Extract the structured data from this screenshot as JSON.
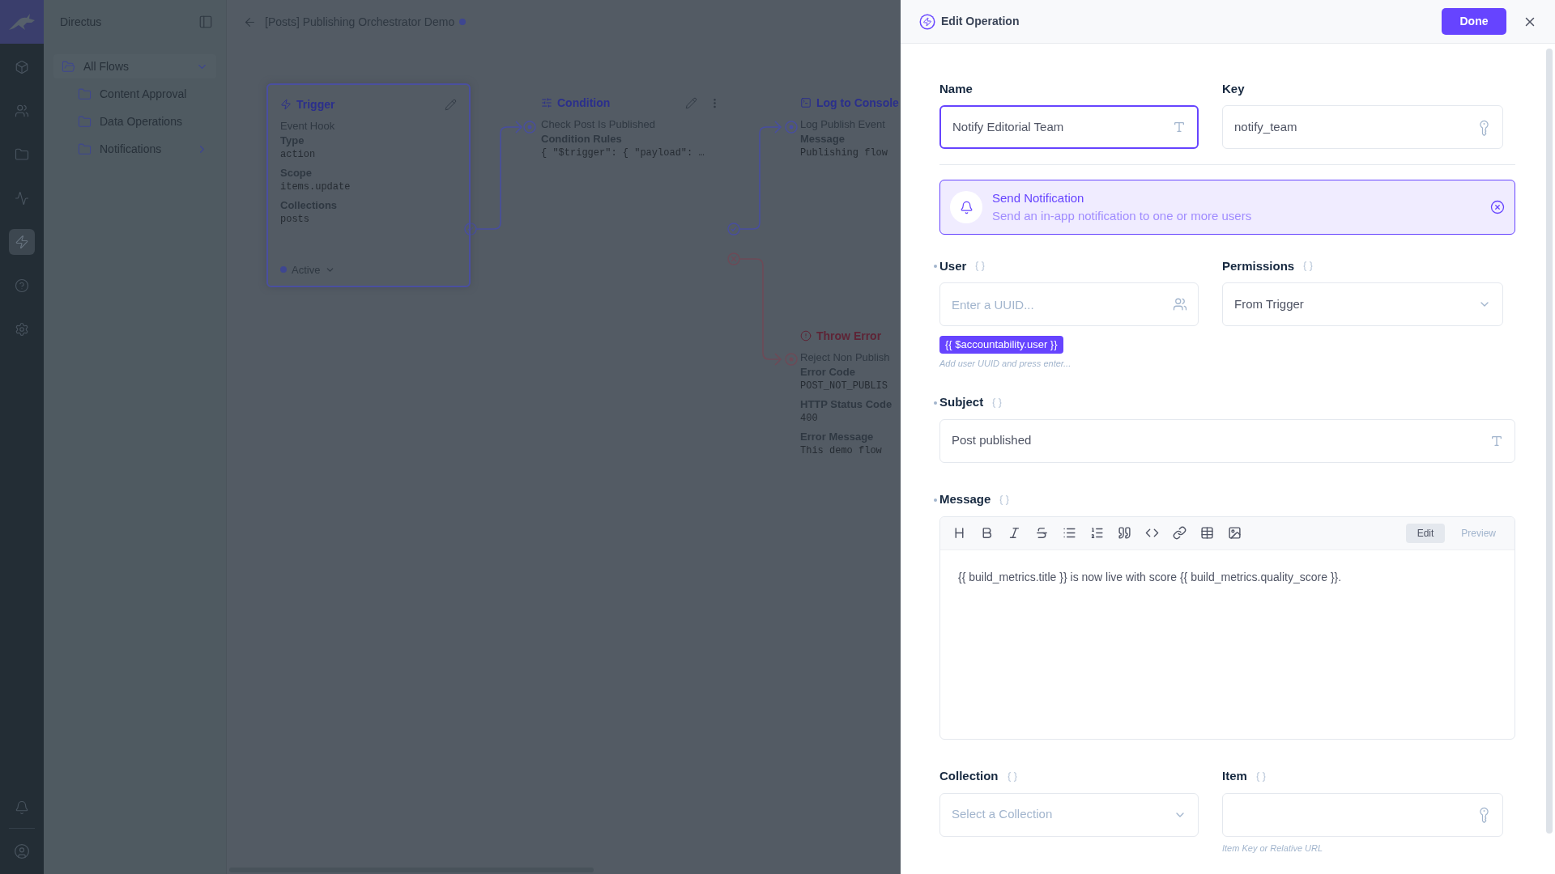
{
  "rail": {
    "items": [
      {
        "selected": false
      },
      {
        "selected": false
      },
      {
        "selected": false
      },
      {
        "selected": false
      },
      {
        "selected": true
      },
      {
        "selected": false
      },
      {
        "selected": false
      }
    ]
  },
  "sidebar": {
    "title": "Directus",
    "items": [
      {
        "label": "All Flows",
        "kind": "root",
        "expanded": true,
        "children": [
          {
            "label": "Content Approval",
            "kind": "folder"
          },
          {
            "label": "Data Operations",
            "kind": "folder"
          },
          {
            "label": "Notifications",
            "kind": "group",
            "expanded": false
          }
        ]
      }
    ]
  },
  "header": {
    "title": "[Posts] Publishing Orchestrator Demo",
    "unsaved": true
  },
  "canvas": {
    "nodes": [
      {
        "kind": "trigger",
        "title": "Trigger",
        "color": "#2b2f8c",
        "name": "Event Hook",
        "fields": [
          {
            "label": "Type",
            "value": "action"
          },
          {
            "label": "Scope",
            "value": "items.update"
          },
          {
            "label": "Collections",
            "value": "posts"
          }
        ],
        "status": "Active"
      },
      {
        "kind": "condition",
        "title": "Condition",
        "color": "#2b2f8c",
        "name": "Check Post Is Published",
        "fields": [
          {
            "label": "Condition Rules",
            "value": "{ \"$trigger\": { \"payload\": …"
          }
        ]
      },
      {
        "kind": "log",
        "title": "Log to Console",
        "color": "#2b2f8c",
        "name": "Log Publish Event",
        "fields": [
          {
            "label": "Message",
            "value": "Publishing flow"
          }
        ]
      },
      {
        "kind": "error",
        "title": "Throw Error",
        "color": "#5e2436",
        "name": "Reject Non Publish",
        "fields": [
          {
            "label": "Error Code",
            "value": "POST_NOT_PUBLIS"
          },
          {
            "label": "HTTP Status Code",
            "value": "400"
          },
          {
            "label": "Error Message",
            "value": "This demo flow"
          }
        ]
      }
    ]
  },
  "drawer": {
    "title": "Edit Operation",
    "done": "Done",
    "name": {
      "label": "Name",
      "focused": true,
      "value": "Notify Editorial Team"
    },
    "key": {
      "label": "Key",
      "value": "notify_team"
    },
    "operation": {
      "title": "Send Notification",
      "description": "Send an in-app notification to one or more users"
    },
    "user": {
      "label": "User",
      "required": true,
      "placeholder": "Enter a UUID...",
      "chips": [
        "{{ $accountability.user }}"
      ],
      "hint": "Add user UUID and press enter..."
    },
    "permissions": {
      "label": "Permissions",
      "value": "From Trigger"
    },
    "subject": {
      "label": "Subject",
      "required": true,
      "value": "Post published"
    },
    "message": {
      "label": "Message",
      "required": true,
      "modes": [
        {
          "label": "Edit",
          "selected": true
        },
        {
          "label": "Preview",
          "selected": false
        }
      ],
      "value": "{{ build_metrics.title }} is now live with score {{ build_metrics.quality_score }}."
    },
    "collection": {
      "label": "Collection",
      "placeholder": "Select a Collection"
    },
    "item": {
      "label": "Item",
      "hint": "Item Key or Relative URL"
    }
  }
}
